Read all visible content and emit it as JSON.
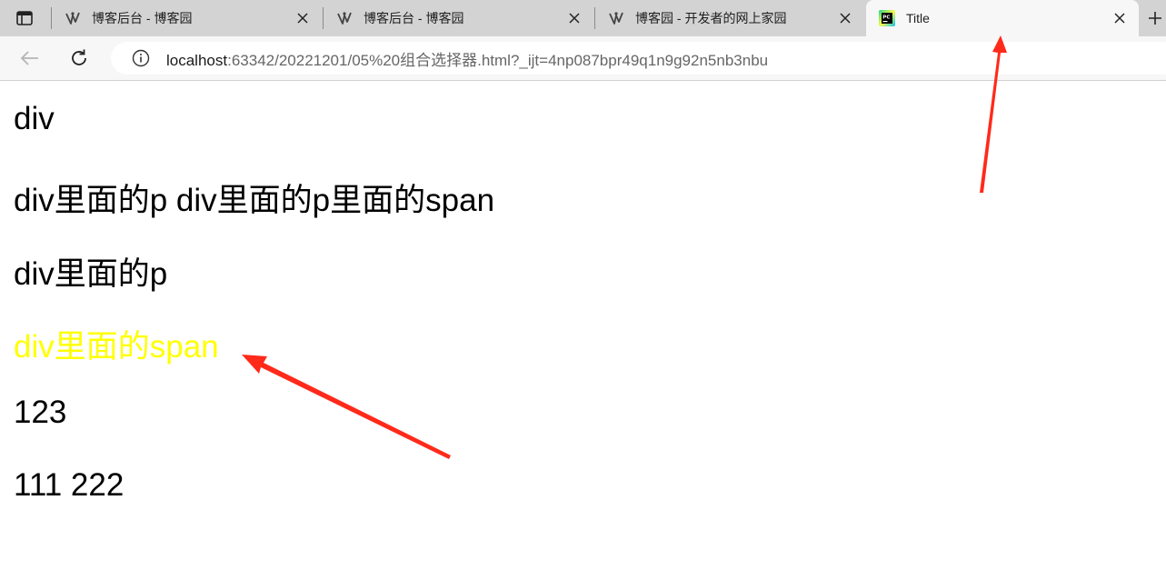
{
  "browser": {
    "tabs": [
      {
        "title": "博客后台 - 博客园",
        "icon": "cnblogs-icon",
        "active": false
      },
      {
        "title": "博客后台 - 博客园",
        "icon": "cnblogs-icon",
        "active": false
      },
      {
        "title": "博客园 - 开发者的网上家园",
        "icon": "cnblogs-icon",
        "active": false
      },
      {
        "title": "Title",
        "icon": "pycharm-icon",
        "active": true
      }
    ],
    "new_tab_icon": "plus-icon",
    "url_host": "localhost",
    "url_rest": ":63342/20221201/05%20组合选择器.html?_ijt=4np087bpr49q1n9g92n5nb3nbu"
  },
  "page": {
    "lines": [
      {
        "text": "div",
        "color": "#000000"
      },
      {
        "text": "div里面的p div里面的p里面的span",
        "color": "#000000"
      },
      {
        "text": "div里面的p",
        "color": "#000000"
      },
      {
        "text": "div里面的span",
        "color": "#ffff00"
      },
      {
        "text": "123",
        "color": "#000000"
      },
      {
        "text": "111 222",
        "color": "#000000"
      }
    ]
  },
  "annotations": {
    "arrow_color": "#ff2a1a"
  }
}
